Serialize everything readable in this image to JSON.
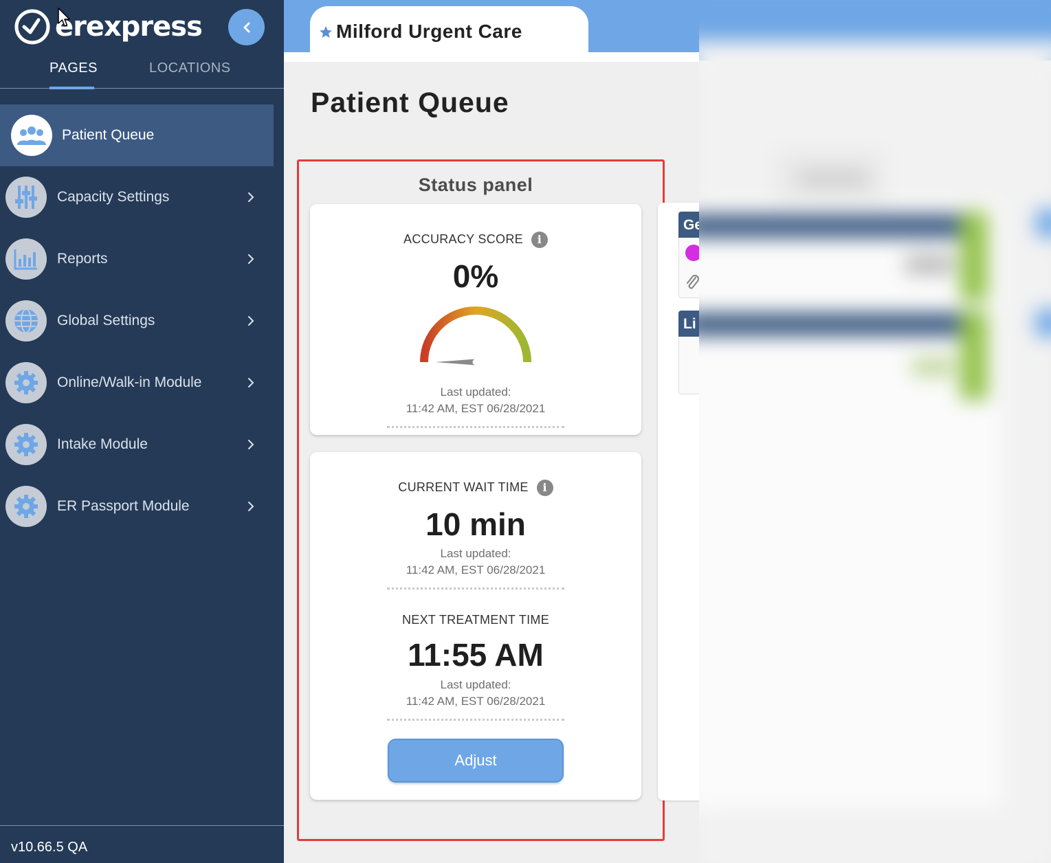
{
  "sidebar": {
    "logo_text": "erexpress",
    "tabs": [
      {
        "label": "PAGES",
        "active": true
      },
      {
        "label": "LOCATIONS",
        "active": false
      }
    ],
    "items": [
      {
        "label": "Patient Queue",
        "icon": "users-icon",
        "active": true
      },
      {
        "label": "Capacity Settings",
        "icon": "sliders-icon",
        "active": false
      },
      {
        "label": "Reports",
        "icon": "bar-chart-icon",
        "active": false
      },
      {
        "label": "Global Settings",
        "icon": "globe-icon",
        "active": false
      },
      {
        "label": "Online/Walk-in Module",
        "icon": "gear-icon",
        "active": false
      },
      {
        "label": "Intake Module",
        "icon": "gear-icon",
        "active": false
      },
      {
        "label": "ER Passport Module",
        "icon": "gear-icon",
        "active": false
      }
    ],
    "version": "v10.66.5 QA"
  },
  "header": {
    "location_title": "Milford Urgent Care"
  },
  "main": {
    "page_title": "Patient Queue",
    "status_panel": {
      "heading": "Status panel",
      "accuracy": {
        "label": "ACCURACY SCORE",
        "value": "0%",
        "gauge_fraction": 0,
        "updated_label": "Last updated:",
        "updated_time": "11:42 AM, EST 06/28/2021"
      },
      "wait_time": {
        "label": "CURRENT WAIT TIME",
        "value": "10 min",
        "updated_label": "Last updated:",
        "updated_time": "11:42 AM, EST 06/28/2021"
      },
      "next_treatment": {
        "label": "NEXT TREATMENT TIME",
        "value": "11:55 AM",
        "updated_label": "Last updated:",
        "updated_time": "11:42 AM, EST 06/28/2021"
      },
      "adjust_label": "Adjust"
    },
    "right_panels": [
      {
        "heading_fragment": "Ge"
      },
      {
        "heading_fragment": "Li"
      }
    ]
  },
  "colors": {
    "sidebar_bg": "#243a57",
    "sidebar_active": "#3c5a82",
    "accent": "#6fa7e6",
    "highlight_outline": "#e23c3c"
  }
}
